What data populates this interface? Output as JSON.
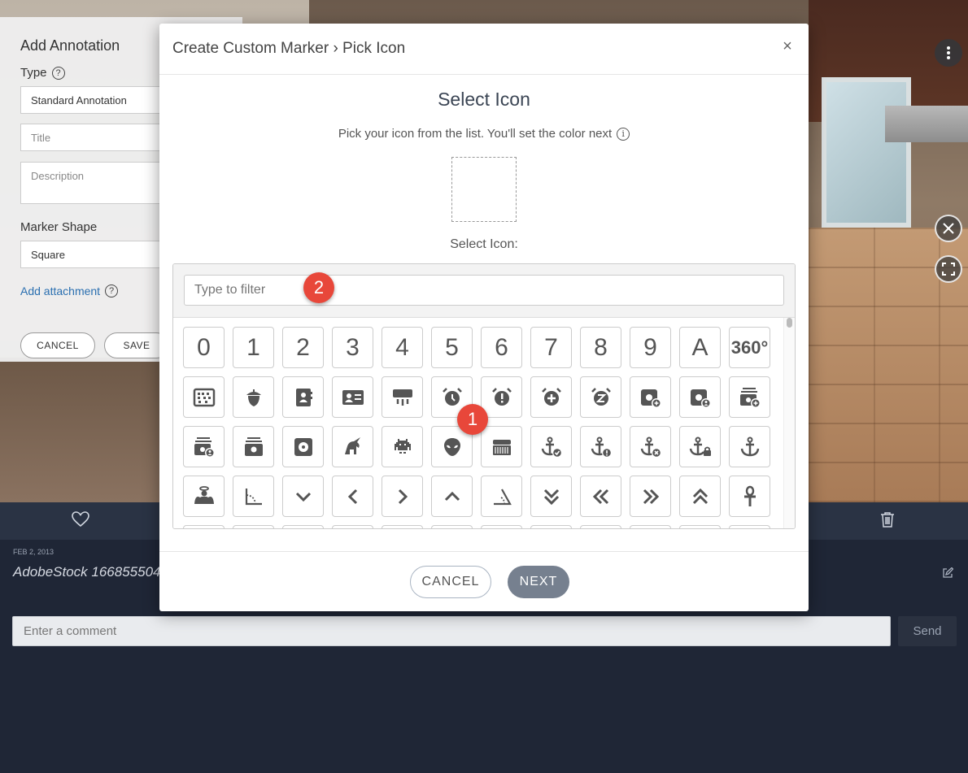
{
  "annotation_panel": {
    "title": "Add Annotation",
    "type_label": "Type",
    "type_value": "Standard Annotation",
    "title_placeholder": "Title",
    "description_placeholder": "Description",
    "marker_shape_label": "Marker Shape",
    "marker_shape_value": "Square",
    "add_attachment": "Add attachment",
    "cancel": "CANCEL",
    "save": "SAVE"
  },
  "meta": {
    "date": "FEB 2, 2013",
    "title": "AdobeStock 166855504",
    "comment_placeholder": "Enter a comment",
    "send": "Send"
  },
  "modal": {
    "breadcrumb": "Create Custom Marker › Pick Icon",
    "close": "×",
    "section_title": "Select Icon",
    "subtitle": "Pick your icon from the list. You'll set the color next",
    "select_label": "Select Icon:",
    "filter_placeholder": "Type to filter",
    "cancel": "CANCEL",
    "next": "NEXT"
  },
  "icon_grid": {
    "rows": [
      [
        "0",
        "1",
        "2",
        "3",
        "4",
        "5",
        "6",
        "7",
        "8",
        "9",
        "A",
        "360°"
      ],
      [
        "abacus",
        "acorn",
        "address-book",
        "address-card",
        "air-conditioner",
        "alarm-clock",
        "alarm-exclamation",
        "alarm-plus",
        "alarm-snooze",
        "album-circle-plus",
        "album-circle-user",
        "album-collection-circle-plus"
      ],
      [
        "album-collection-circle-user",
        "album-collection",
        "album",
        "alicorn",
        "alien-8bit",
        "alien",
        "accordion",
        "anchor-circle-check",
        "anchor-circle-exclamation",
        "anchor-circle-xmark",
        "anchor-lock",
        "anchor"
      ],
      [
        "angel",
        "angle-90",
        "angle-down",
        "angle-left",
        "angle-right",
        "angle-up",
        "angle",
        "angles-down",
        "angles-left",
        "angles-right",
        "angles-up",
        "ankh"
      ]
    ]
  },
  "badges": [
    "1",
    "2"
  ]
}
